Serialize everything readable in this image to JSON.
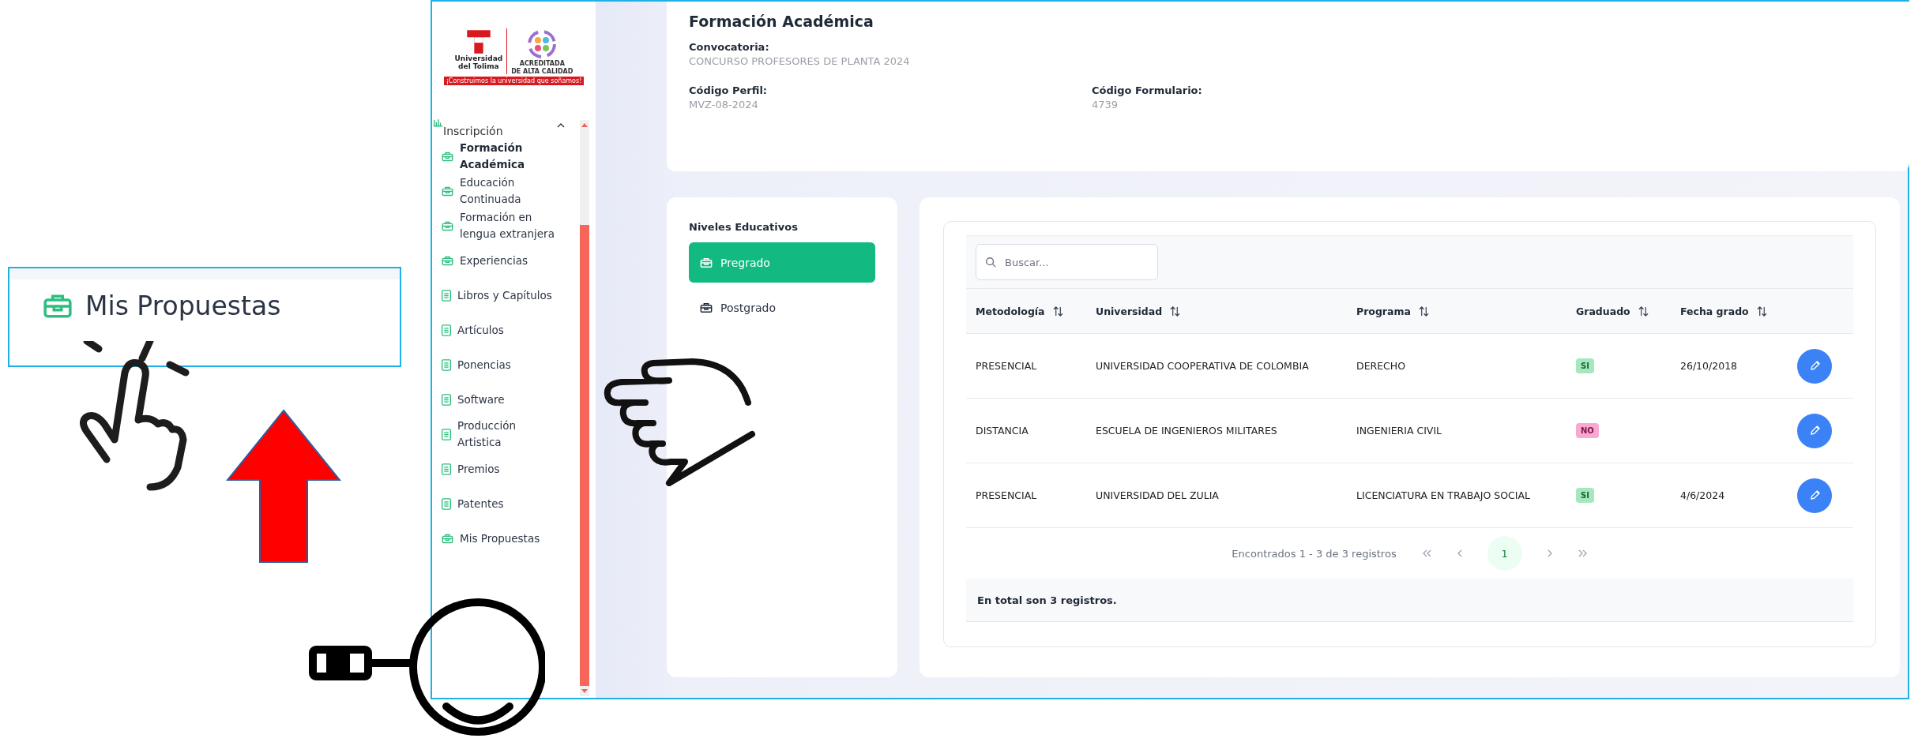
{
  "callout": {
    "label": "Mis Propuestas"
  },
  "app": {
    "sidebar": {
      "logo": {
        "name_line1": "Universidad",
        "name_line2": "del Tolima",
        "badge_line1": "ACREDITADA",
        "badge_line2": "DE ALTA CALIDAD",
        "slogan": "¡Construimos la universidad que soñamos!"
      },
      "section": {
        "label": "Inscripción",
        "expanded": true
      },
      "items": [
        {
          "label": "Formación Académica",
          "kind": "briefcase",
          "selected": true
        },
        {
          "label": "Educación Continuada",
          "kind": "briefcase",
          "selected": false
        },
        {
          "label": "Formación en lengua extranjera",
          "kind": "briefcase",
          "selected": false
        },
        {
          "label": "Experiencias",
          "kind": "briefcase",
          "selected": false
        },
        {
          "label": "Libros y Capítulos",
          "kind": "document",
          "selected": false
        },
        {
          "label": "Artículos",
          "kind": "document",
          "selected": false
        },
        {
          "label": "Ponencias",
          "kind": "document",
          "selected": false
        },
        {
          "label": "Software",
          "kind": "document",
          "selected": false
        },
        {
          "label": "Producción Artistica",
          "kind": "document",
          "selected": false
        },
        {
          "label": "Premios",
          "kind": "document",
          "selected": false
        },
        {
          "label": "Patentes",
          "kind": "document",
          "selected": false
        },
        {
          "label": "Mis Propuestas",
          "kind": "briefcase",
          "selected": false
        }
      ]
    },
    "header": {
      "title": "Formación Académica",
      "fields": [
        {
          "label": "Convocatoria:",
          "value": "CONCURSO PROFESORES DE PLANTA 2024"
        },
        {
          "label": "Código Perfil:",
          "value": "MVZ-08-2024"
        },
        {
          "label": "Código Formulario:",
          "value": "4739"
        }
      ]
    },
    "levels": {
      "title": "Niveles Educativos",
      "items": [
        {
          "label": "Pregrado",
          "selected": true
        },
        {
          "label": "Postgrado",
          "selected": false
        }
      ]
    },
    "table": {
      "search": {
        "placeholder": "Buscar..."
      },
      "columns": [
        "Metodología",
        "Universidad",
        "Programa",
        "Graduado",
        "Fecha grado"
      ],
      "rows": [
        {
          "metodologia": "PRESENCIAL",
          "universidad": "UNIVERSIDAD COOPERATIVA DE COLOMBIA",
          "programa": "DERECHO",
          "graduado": {
            "text": "SI",
            "kind": "yes"
          },
          "fecha": "26/10/2018"
        },
        {
          "metodologia": "DISTANCIA",
          "universidad": "ESCUELA DE INGENIEROS MILITARES",
          "programa": "INGENIERIA CIVIL",
          "graduado": {
            "text": "NO",
            "kind": "no"
          },
          "fecha": ""
        },
        {
          "metodologia": "PRESENCIAL",
          "universidad": "UNIVERSIDAD DEL ZULIA",
          "programa": "LICENCIATURA EN TRABAJO SOCIAL",
          "graduado": {
            "text": "SI",
            "kind": "yes"
          },
          "fecha": "4/6/2024"
        }
      ],
      "pagination": {
        "summary": "Encontrados 1 - 3 de 3 registros",
        "pages": [
          {
            "label": "1",
            "selected": true
          }
        ]
      },
      "footer": "En total son 3 registros."
    }
  }
}
